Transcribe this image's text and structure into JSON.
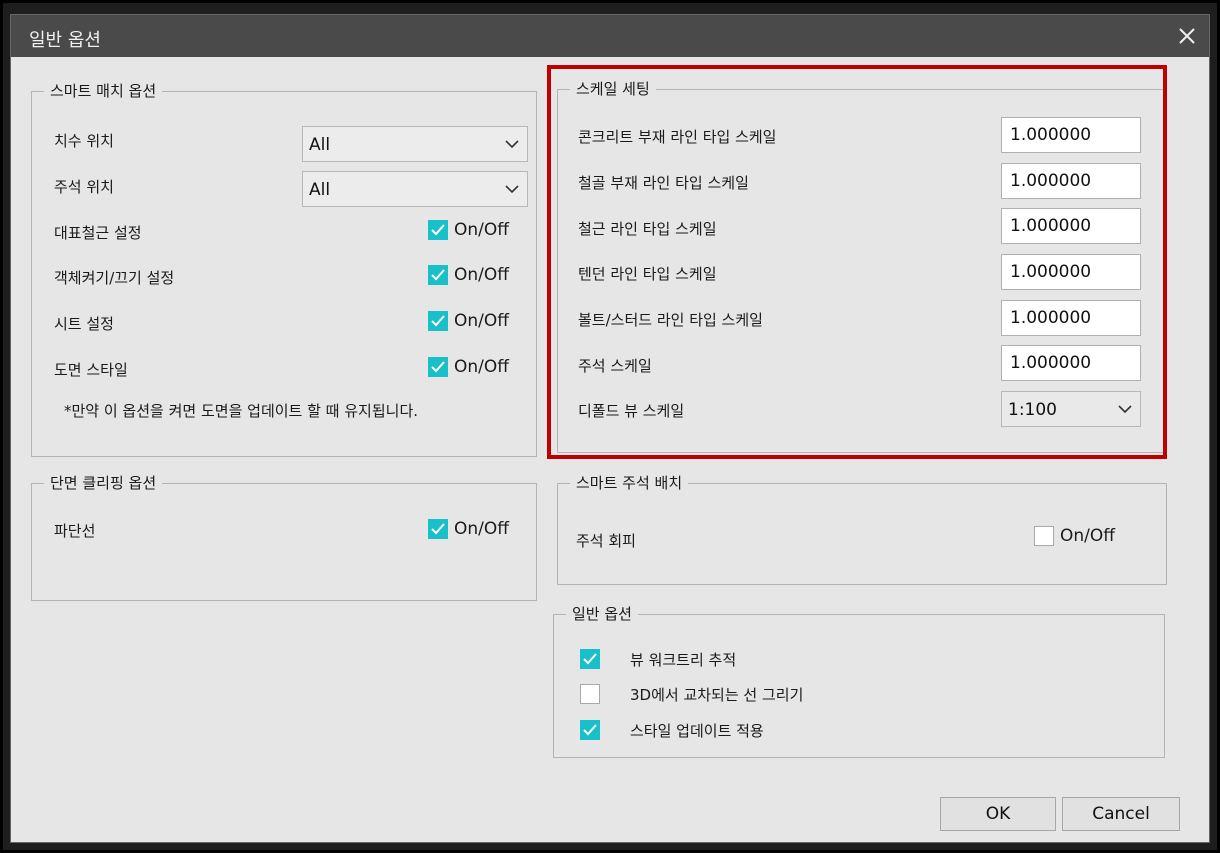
{
  "window": {
    "title": "일반 옵션"
  },
  "smart_match": {
    "title": "스마트 매치 옵션",
    "dim_position": {
      "label": "치수 위치",
      "value": "All"
    },
    "note_position": {
      "label": "주석 위치",
      "value": "All"
    },
    "toggles": [
      {
        "label": "대표철근 설정",
        "state": "On/Off",
        "checked": true
      },
      {
        "label": "객체켜기/끄기 설정",
        "state": "On/Off",
        "checked": true
      },
      {
        "label": "시트 설정",
        "state": "On/Off",
        "checked": true
      },
      {
        "label": "도면 스타일",
        "state": "On/Off",
        "checked": true
      }
    ],
    "note_text": "*만약 이 옵션을 켜면 도면을 업데이트 할 때 유지됩니다."
  },
  "section_clip": {
    "title": "단면 클리핑 옵션",
    "break_line": {
      "label": "파단선",
      "state": "On/Off",
      "checked": true
    }
  },
  "scale_settings": {
    "title": "스케일 세팅",
    "rows": [
      {
        "label": "콘크리트 부재 라인 타입 스케일",
        "value": "1.000000"
      },
      {
        "label": "철골 부재 라인 타입 스케일",
        "value": "1.000000"
      },
      {
        "label": "철근 라인 타입 스케일",
        "value": "1.000000"
      },
      {
        "label": "텐던 라인 타입 스케일",
        "value": "1.000000"
      },
      {
        "label": "볼트/스터드 라인 타입 스케일",
        "value": "1.000000"
      },
      {
        "label": "주석 스케일",
        "value": "1.000000"
      }
    ],
    "fold_view": {
      "label": "디폴드 뷰 스케일",
      "value": "1:100"
    }
  },
  "smart_note": {
    "title": "스마트 주석 배치",
    "avoid": {
      "label": "주석 회피",
      "state": "On/Off",
      "checked": false
    }
  },
  "general": {
    "title": "일반 옵션",
    "rows": [
      {
        "label": "뷰 워크트리 추적",
        "checked": true
      },
      {
        "label": "3D에서 교차되는 선 그리기",
        "checked": false
      },
      {
        "label": "스타일 업데이트 적용",
        "checked": true
      }
    ]
  },
  "buttons": {
    "ok": "OK",
    "cancel": "Cancel"
  },
  "colors": {
    "accent": "#19c0c9",
    "highlight": "#c00000",
    "titlebar": "#4a4a4a"
  }
}
